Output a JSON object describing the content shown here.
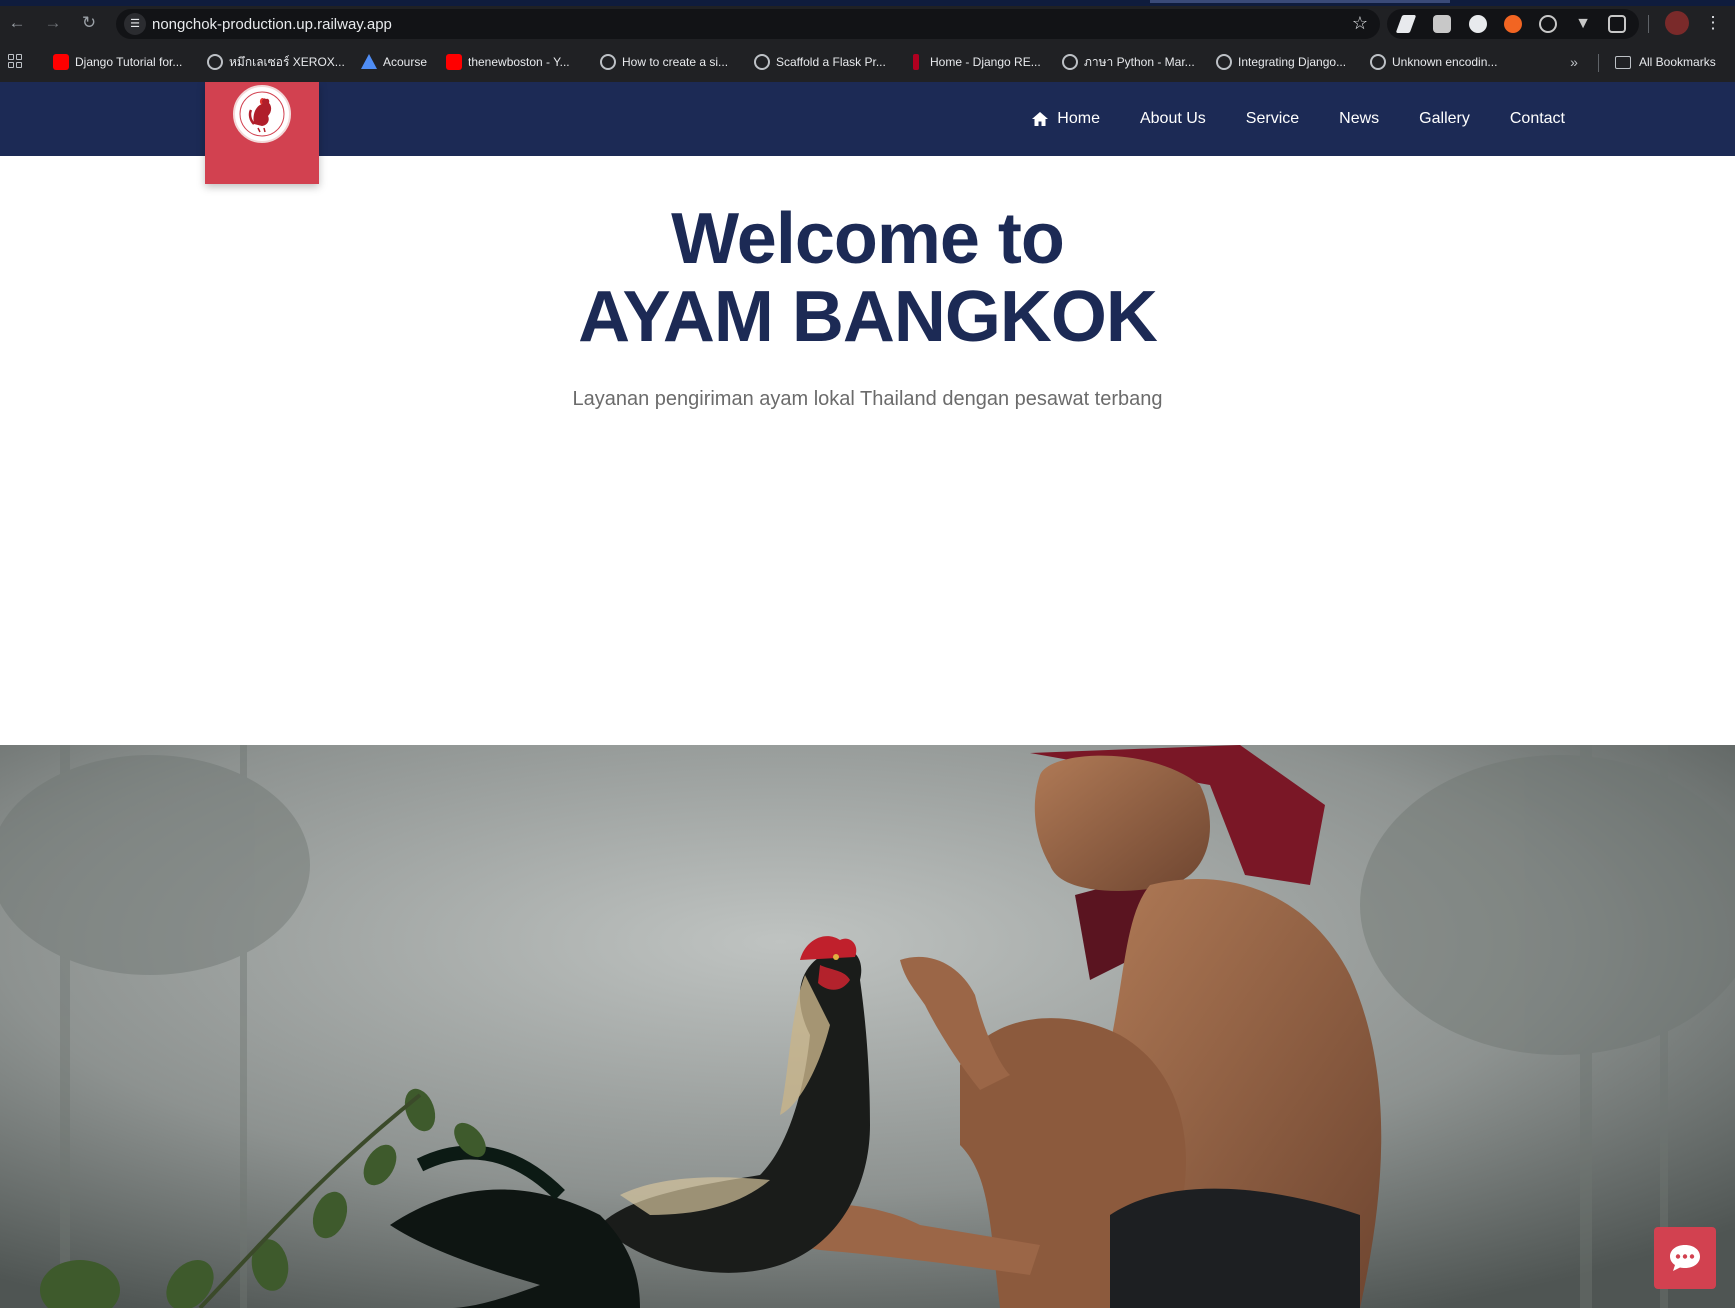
{
  "browser": {
    "url": "nongchok-production.up.railway.app",
    "bookmarks": [
      {
        "label": "Django Tutorial for...",
        "icon": "youtube-icon"
      },
      {
        "label": "หมึกเลเซอร์ XEROX...",
        "icon": "globe-icon"
      },
      {
        "label": "Acourse",
        "icon": "acourse-icon"
      },
      {
        "label": "thenewboston - Y...",
        "icon": "youtube-icon"
      },
      {
        "label": "How to create a si...",
        "icon": "globe-icon"
      },
      {
        "label": "Scaffold a Flask Pr...",
        "icon": "globe-icon"
      },
      {
        "label": "Home - Django RE...",
        "icon": "drf-icon"
      },
      {
        "label": "ภาษา Python - Mar...",
        "icon": "globe-icon"
      },
      {
        "label": "Integrating Django...",
        "icon": "globe-icon"
      },
      {
        "label": "Unknown encodin...",
        "icon": "globe-icon"
      }
    ],
    "all_bookmarks_label": "All Bookmarks"
  },
  "site": {
    "nav": [
      {
        "label": "Home",
        "icon": "home-icon"
      },
      {
        "label": "About Us"
      },
      {
        "label": "Service"
      },
      {
        "label": "News"
      },
      {
        "label": "Gallery"
      },
      {
        "label": "Contact"
      }
    ],
    "hero": {
      "title_line1": "Welcome to",
      "title_line2": "AYAM BANGKOK",
      "subtitle": "Layanan pengiriman ayam lokal Thailand dengan pesawat terbang"
    },
    "colors": {
      "navbar": "#1c2a55",
      "accent": "#d24150",
      "heading": "#1c2a55"
    }
  }
}
